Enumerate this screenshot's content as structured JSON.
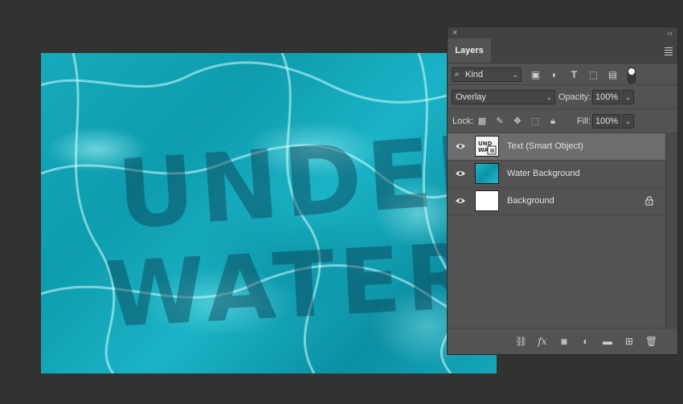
{
  "canvas": {
    "line1": "UNDER",
    "line2": "WATER"
  },
  "panel": {
    "close_glyph": "×",
    "collapse_glyph": "‹‹",
    "tab_label": "Layers",
    "filter": {
      "value": "Kind",
      "icons": [
        "image-filter-icon",
        "adjustment-filter-icon",
        "type-filter-icon",
        "shape-filter-icon",
        "smart-object-filter-icon",
        "filter-toggle-icon"
      ]
    },
    "blend_mode": "Overlay",
    "opacity_label": "Opacity:",
    "opacity_value": "100%",
    "lock_label": "Lock:",
    "fill_label": "Fill:",
    "fill_value": "100%",
    "layers": [
      {
        "name": "Text (Smart Object)",
        "thumb": "text",
        "visible": true,
        "selected": true,
        "locked": false
      },
      {
        "name": "Water Background",
        "thumb": "water",
        "visible": true,
        "selected": false,
        "locked": false
      },
      {
        "name": "Background",
        "thumb": "bg",
        "visible": true,
        "selected": false,
        "locked": true
      }
    ],
    "footer_icons": [
      "link-layers-icon",
      "fx-icon",
      "add-mask-icon",
      "adjustment-layer-icon",
      "group-folder-icon",
      "new-layer-icon",
      "trash-icon"
    ]
  },
  "colors": {
    "app_bg": "#323232",
    "panel_bg": "#535353",
    "selected_row": "#6d6d6d",
    "water": "#17a9bd"
  }
}
